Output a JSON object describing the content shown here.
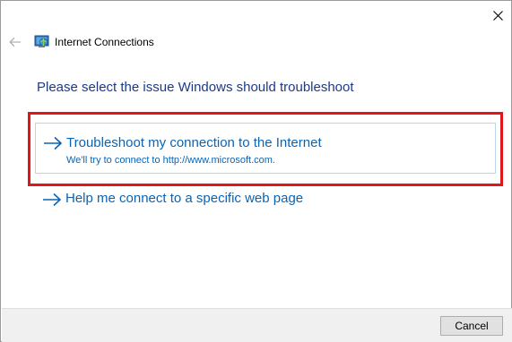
{
  "window": {
    "title": "Internet Connections",
    "close_icon": "close-icon",
    "back_icon": "back-arrow-icon",
    "app_icon": "internet-connections-icon"
  },
  "main": {
    "heading": "Please select the issue Windows should troubleshoot",
    "options": [
      {
        "title": "Troubleshoot my connection to the Internet",
        "subtitle": "We'll try to connect to http://www.microsoft.com.",
        "icon": "right-arrow-icon",
        "highlighted": true
      },
      {
        "title": "Help me connect to a specific web page",
        "icon": "right-arrow-icon"
      }
    ]
  },
  "footer": {
    "cancel_label": "Cancel"
  },
  "colors": {
    "link": "#0a64b4",
    "heading": "#1c3a8a",
    "highlight_border": "#e0161c",
    "footer_bg": "#f0f0f0"
  }
}
